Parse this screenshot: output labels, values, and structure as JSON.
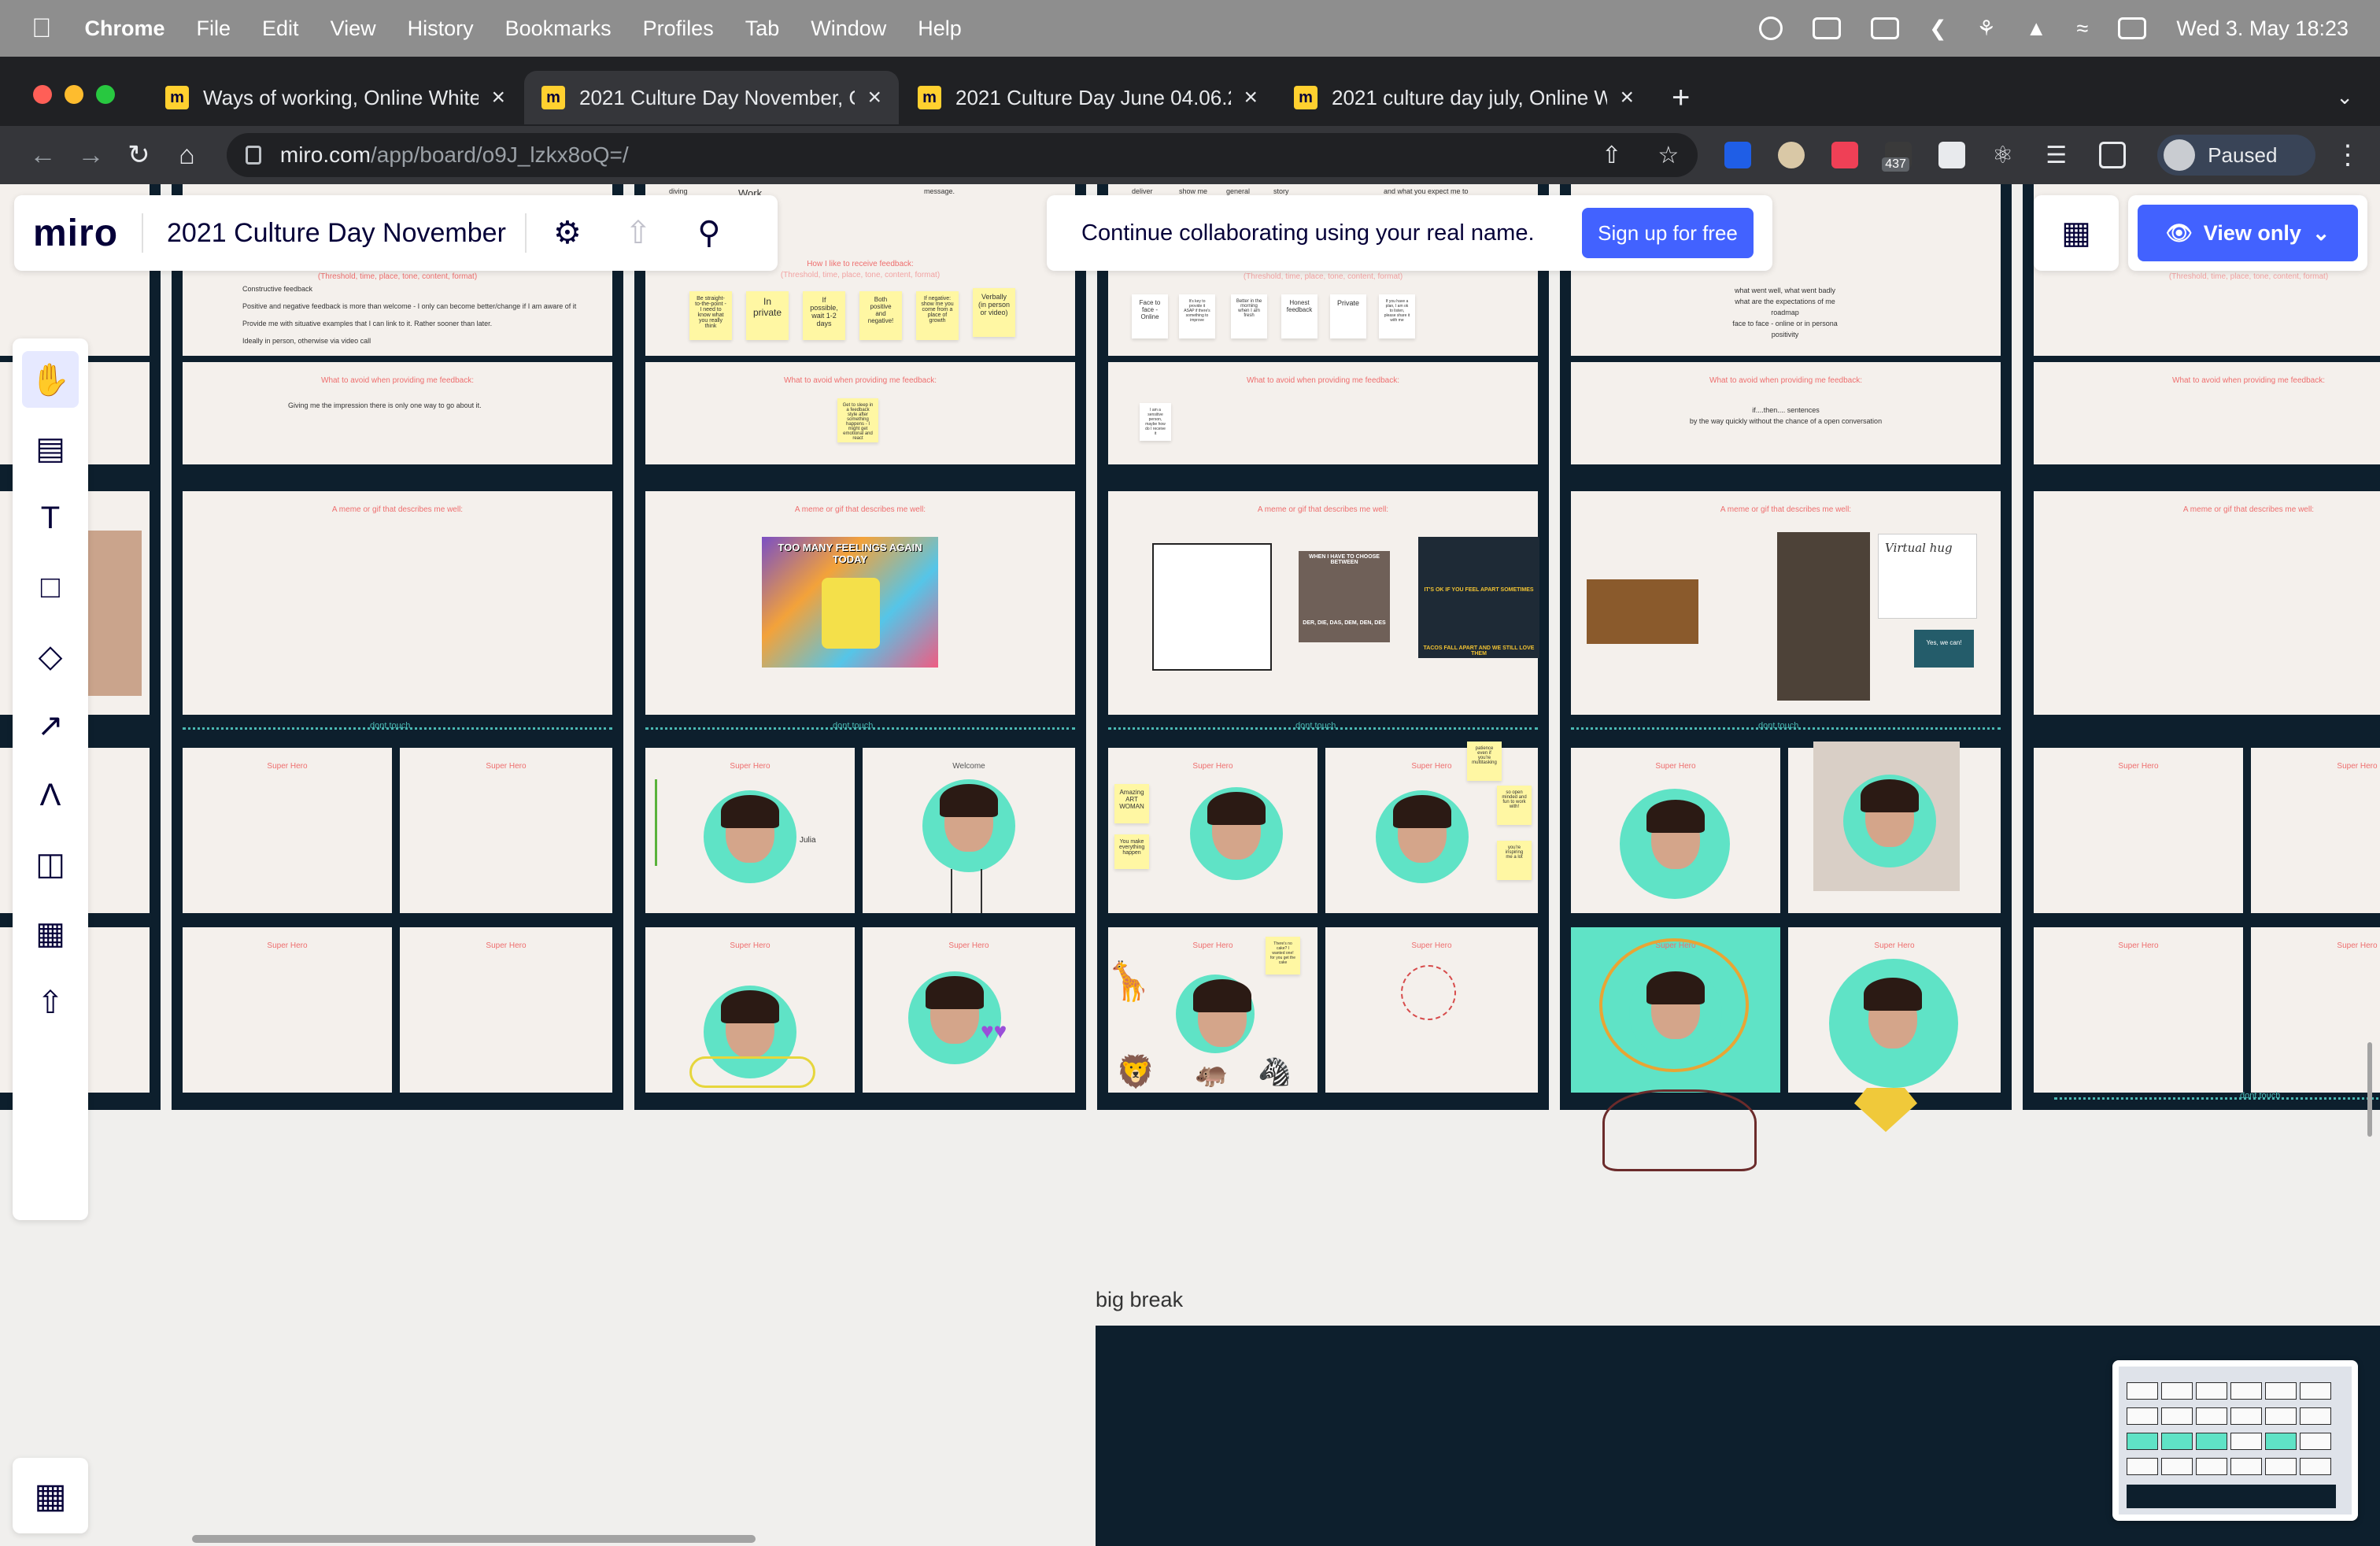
{
  "menubar": {
    "app": "Chrome",
    "items": [
      "File",
      "Edit",
      "View",
      "History",
      "Bookmarks",
      "Profiles",
      "Tab",
      "Window",
      "Help"
    ],
    "datetime": "Wed 3. May  18:23"
  },
  "tabs": [
    {
      "title": "Ways of working, Online Whitel"
    },
    {
      "title": "2021 Culture Day November, O"
    },
    {
      "title": "2021 Culture Day June 04.06.2"
    },
    {
      "title": "2021 culture day july, Online W"
    }
  ],
  "address": {
    "host": "miro.com",
    "path": "/app/board/o9J_lzkx8oQ=/"
  },
  "extensions": {
    "badge_count": "437"
  },
  "profile": {
    "label": "Paused"
  },
  "board": {
    "logo": "miro",
    "title": "2021 Culture Day November"
  },
  "collab": {
    "message": "Continue collaborating using your real name.",
    "signup": "Sign up for free"
  },
  "view": {
    "label": "View only"
  },
  "canvas": {
    "break_label": "big break",
    "frame_labels": {
      "feedback_receive": "How I like to receive feedback:",
      "feedback_hint": "(Threshold, time, place, tone, content, format)",
      "avoid": "What to avoid when providing me feedback:",
      "meme": "A meme or gif that describes me well:",
      "super_hero": "Super Hero",
      "dont_touch": "dont touch"
    },
    "col2_feedback": [
      "Constructive feedback",
      "Positive and negative feedback is more than welcome - I only can become better/change if I am aware of it",
      "Provide me with situative examples that I can link to it. Rather sooner than later.",
      "Ideally in person, otherwise via video call"
    ],
    "col2_avoid": "Giving me the impression there is only one way to go about it.",
    "col3_stickies": [
      "Be straight-to-the-point - I need to know what you really think",
      "In private",
      "If possible, wait 1-2 days",
      "Both positive and negative!",
      "If negative: show me you come from a place of growth",
      "Verbally (in person or video)"
    ],
    "col3_avoid_sticky": "Get to sleep in a feedback style after something happens - I might get emotional and react",
    "col3_top": [
      "diving",
      "Work",
      "message."
    ],
    "col4_top": [
      "deliver",
      "show me",
      "general",
      "story",
      "and what you expect me to"
    ],
    "col4_stickies": [
      "Face to face - Online",
      "It's key to provide it ASAP if there's something to improve",
      "Better in the morning when I am fresh",
      "Honest feedback",
      "Private",
      "If you have a plan, I am ok to listen, please share it with me"
    ],
    "col4_avoid_sticky": "I am a sensitive person, maybe how do I receive it",
    "col4_hero_stickies": [
      "Amazing ART WOMAN",
      "You make everything happen",
      "patience even if you're multitasking",
      "so open minded and fun to work with!",
      "you're inspiring me a lot",
      "There's no cake? I wanted one! for you get the cake"
    ],
    "col5_feedback": [
      "what went well, what went badly",
      "what are the expectations of me",
      "roadmap",
      "face to face - online or in persona",
      "positivity"
    ],
    "col5_avoid": [
      "if....then.... sentences",
      "by the way quickly without the chance of a open conversation"
    ],
    "meme_texts": [
      "TOO MANY FEELINGS AGAIN TODAY",
      "WHEN I HAVE TO CHOOSE BETWEEN",
      "DER, DIE, DAS, DEM, DEN, DES",
      "IT'S OK IF YOU FEEL APART SOMETIMES",
      "TACOS FALL APART AND WE STILL LOVE THEM",
      "Virtual hug",
      "Yes, we can!"
    ],
    "doodle_texts": [
      "Welcome",
      "Julia"
    ]
  }
}
